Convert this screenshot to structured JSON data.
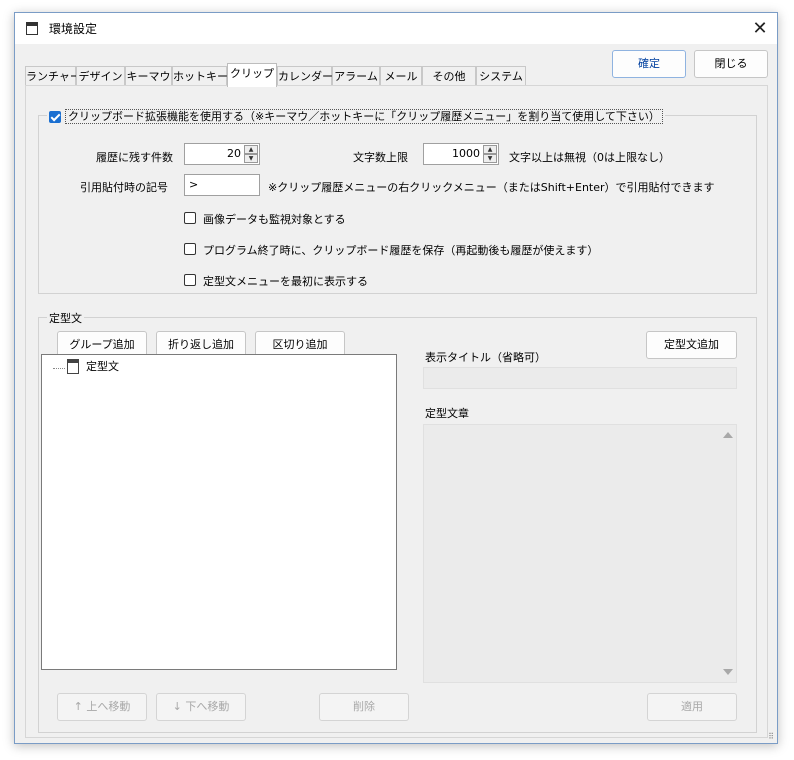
{
  "window": {
    "title": "環境設定",
    "close": "✕"
  },
  "tabs": [
    {
      "label": "ランチャー"
    },
    {
      "label": "デザイン"
    },
    {
      "label": "キーマウ"
    },
    {
      "label": "ホットキー"
    },
    {
      "label": "クリップ"
    },
    {
      "label": "カレンダー"
    },
    {
      "label": "アラーム"
    },
    {
      "label": "メール"
    },
    {
      "label": "その他"
    },
    {
      "label": "システム"
    }
  ],
  "active_tab": "クリップ",
  "buttons": {
    "ok": "確定",
    "close": "閉じる"
  },
  "clip": {
    "enable_label": "クリップボード拡張機能を使用する（※キーマウ／ホットキーに「クリップ履歴メニュー」を割り当て使用して下さい）",
    "enabled": true,
    "history_label": "履歴に残す件数",
    "history_value": "20",
    "maxchars_label": "文字数上限",
    "maxchars_value": "1000",
    "maxchars_suffix": "文字以上は無視（0は上限なし）",
    "quote_label": "引用貼付時の記号",
    "quote_value": ">",
    "quote_note": "※クリップ履歴メニューの右クリックメニュー（またはShift+Enter）で引用貼付できます",
    "options": [
      {
        "label": "画像データも監視対象とする",
        "checked": false
      },
      {
        "label": "プログラム終了時に、クリップボード履歴を保存（再起動後も履歴が使えます）",
        "checked": false
      },
      {
        "label": "定型文メニューを最初に表示する",
        "checked": false
      }
    ]
  },
  "teikei": {
    "group_label": "定型文",
    "add_group": "グループ追加",
    "add_wrap": "折り返し追加",
    "add_separator": "区切り追加",
    "tree_root": "定型文",
    "title_label": "表示タイトル（省略可）",
    "add_teikei": "定型文追加",
    "body_label": "定型文章",
    "move_up": "↑ 上へ移動",
    "move_down": "↓ 下へ移動",
    "delete": "削除",
    "apply": "適用"
  }
}
